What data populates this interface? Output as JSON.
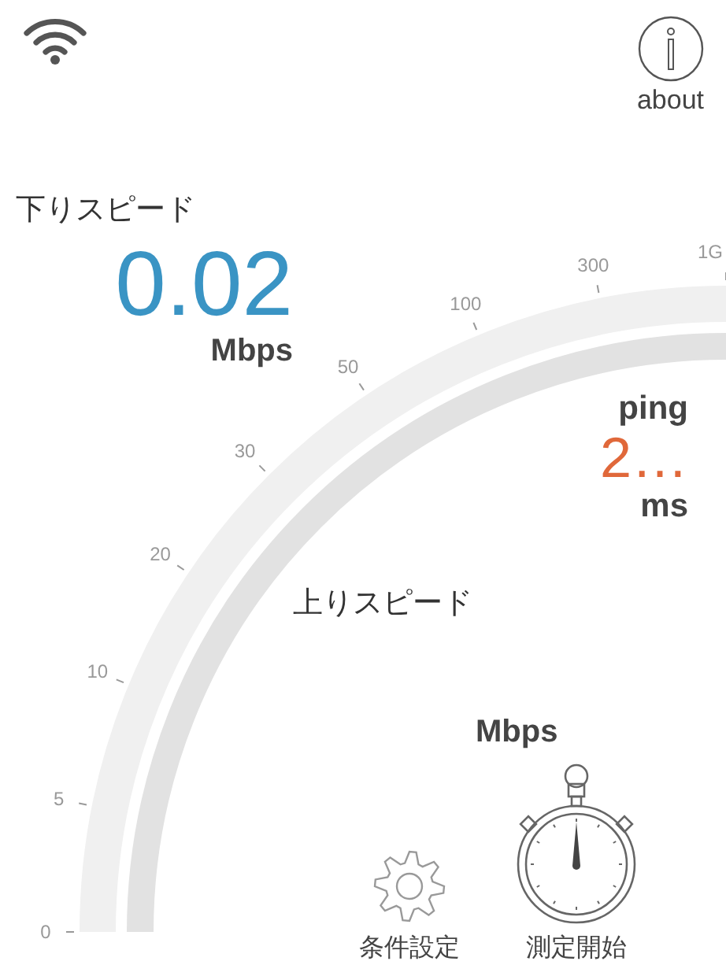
{
  "header": {
    "about_label": "about"
  },
  "download": {
    "label": "下りスピード",
    "value": "0.02",
    "unit": "Mbps"
  },
  "ping": {
    "label": "ping",
    "value": "2…",
    "unit": "ms"
  },
  "upload": {
    "label": "上りスピード",
    "unit": "Mbps"
  },
  "gauge": {
    "ticks": [
      "0",
      "5",
      "10",
      "20",
      "30",
      "50",
      "100",
      "300",
      "1G"
    ]
  },
  "actions": [
    {
      "kind": "settings",
      "label": "条件設定"
    },
    {
      "kind": "start",
      "label": "測定開始"
    }
  ]
}
